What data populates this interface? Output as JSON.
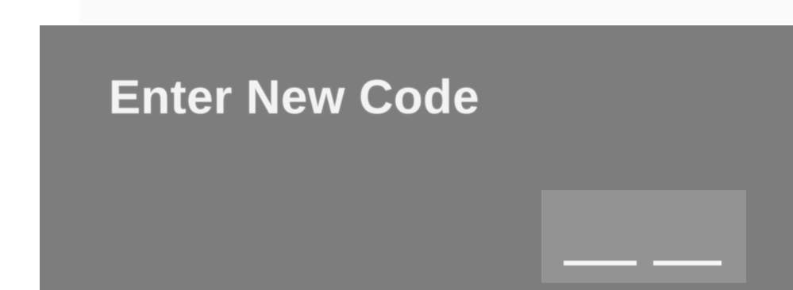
{
  "dialog": {
    "title": "Enter New Code"
  },
  "code_entry": {
    "digit_slots": 2,
    "entered_value": ""
  },
  "colors": {
    "dialog_background": "#7d7d7d",
    "title_text": "#f3f3f3",
    "code_box_background": "#939393",
    "slot_underline": "#f7f7f7"
  }
}
